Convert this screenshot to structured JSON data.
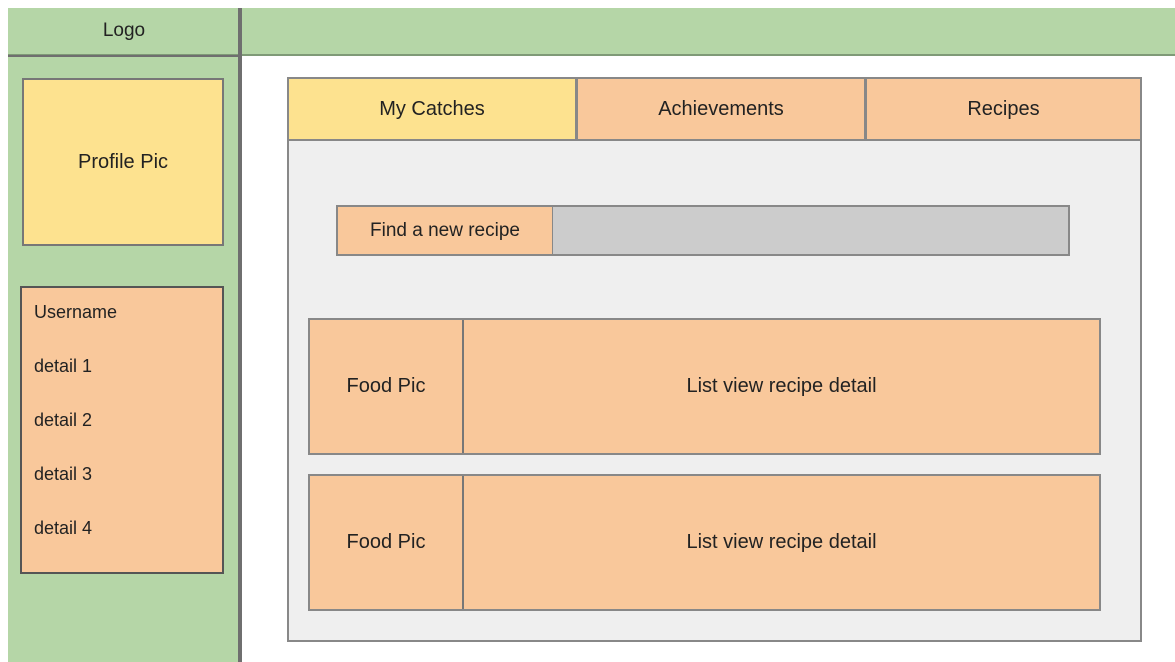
{
  "header": {
    "logo": "Logo"
  },
  "sidebar": {
    "profile_pic": "Profile Pic",
    "details": [
      "Username",
      "detail 1",
      "detail 2",
      "detail 3",
      "detail 4"
    ]
  },
  "tabs": [
    {
      "label": "My Catches",
      "active": true
    },
    {
      "label": "Achievements",
      "active": false
    },
    {
      "label": "Recipes",
      "active": false
    }
  ],
  "search": {
    "label": "Find a new recipe",
    "value": ""
  },
  "recipes": [
    {
      "pic": "Food Pic",
      "detail": "List view recipe detail"
    },
    {
      "pic": "Food Pic",
      "detail": "List view recipe detail"
    }
  ],
  "colors": {
    "green": "#b5d6a7",
    "yellow": "#fde28f",
    "orange": "#f9c89b",
    "gray_panel": "#efefef",
    "gray_input": "#cccccc"
  }
}
